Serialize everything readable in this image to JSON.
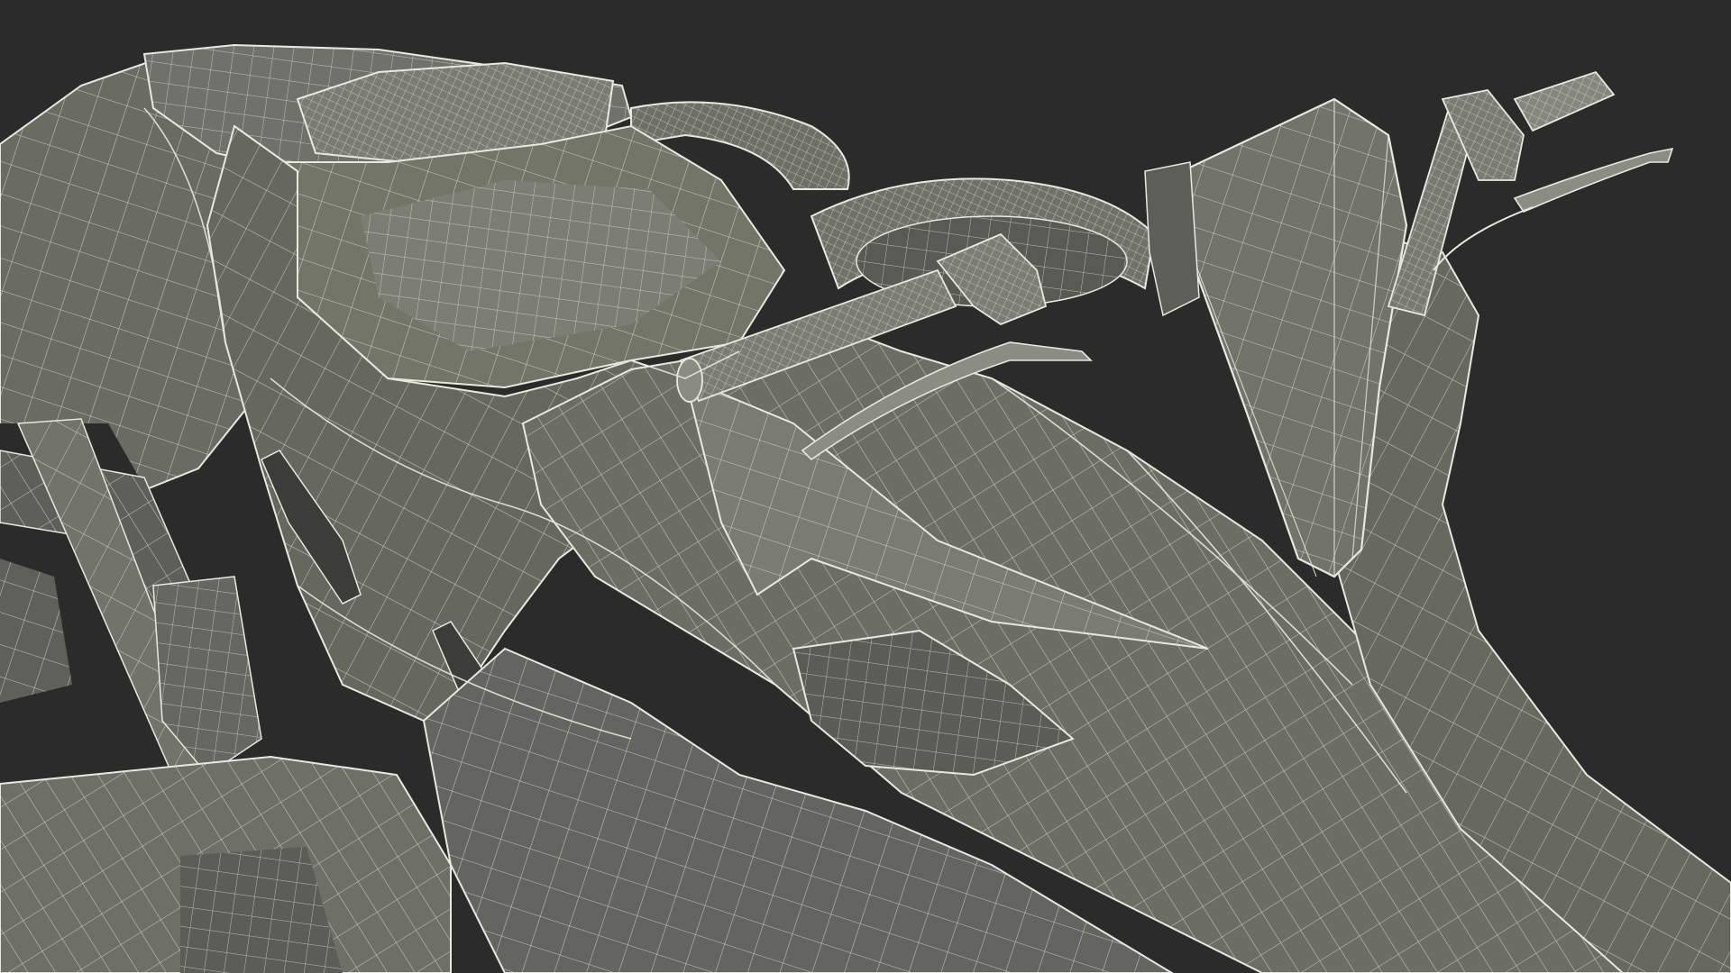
{
  "scene": {
    "subject": "wireframe-render",
    "colors": {
      "background": "#2b2b2b",
      "surface": "#6a6b63",
      "surface_light": "#7d7e75",
      "surface_dark": "#54554e",
      "shadow": "#3c3d38",
      "wire": "#e8e8e0"
    }
  }
}
